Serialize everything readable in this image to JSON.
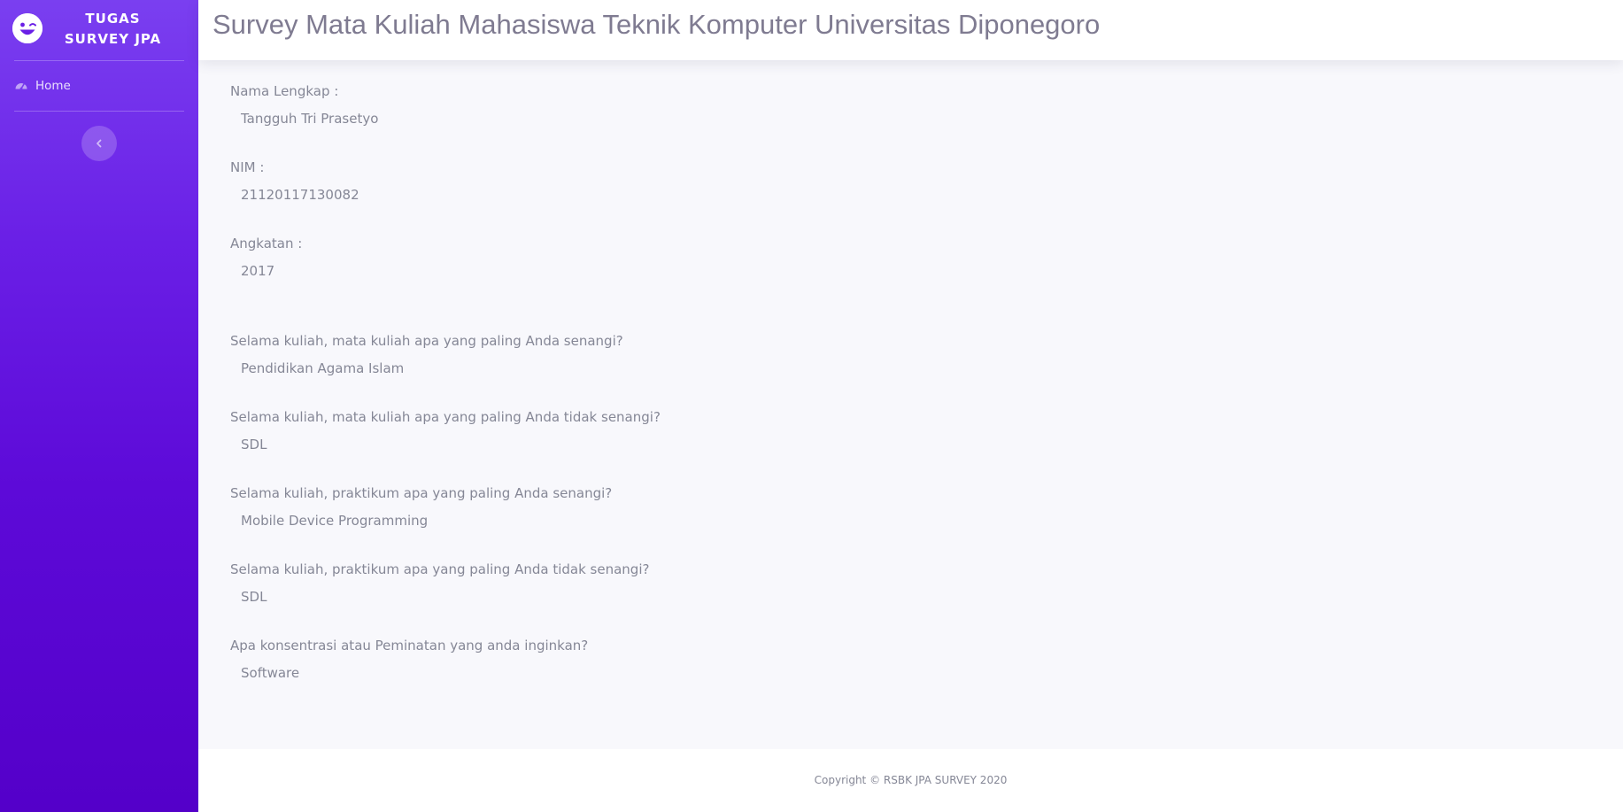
{
  "sidebar": {
    "brand_line1": "TUGAS",
    "brand_line2": "SURVEY JPA",
    "logo_icon": "laugh-wink-icon",
    "nav_items": [
      {
        "label": "Home",
        "icon": "tachometer-icon"
      }
    ],
    "toggle_icon": "chevron-left-icon"
  },
  "header": {
    "title": "Survey Mata Kuliah Mahasiswa Teknik Komputer Universitas Diponegoro"
  },
  "fields": [
    {
      "question": "Nama Lengkap :",
      "answer": "Tangguh Tri Prasetyo"
    },
    {
      "question": "NIM :",
      "answer": "21120117130082"
    },
    {
      "question": "Angkatan :",
      "answer": "2017"
    },
    {
      "question": "Selama kuliah, mata kuliah apa yang paling Anda senangi?",
      "answer": "Pendidikan Agama Islam"
    },
    {
      "question": "Selama kuliah, mata kuliah apa yang paling Anda tidak senangi?",
      "answer": "SDL"
    },
    {
      "question": "Selama kuliah, praktikum apa yang paling Anda senangi?",
      "answer": "Mobile Device Programming"
    },
    {
      "question": "Selama kuliah, praktikum apa yang paling Anda tidak senangi?",
      "answer": "SDL"
    },
    {
      "question": "Apa konsentrasi atau Peminatan yang anda inginkan?",
      "answer": "Software"
    }
  ],
  "footer": {
    "copyright": "Copyright © RSBK JPA SURVEY 2020"
  },
  "colors": {
    "sidebar_top": "#7a3ff0",
    "sidebar_bottom": "#5400c9",
    "text_muted": "#858796",
    "title_text": "#7f7b91",
    "page_bg": "#f8f8fc"
  }
}
